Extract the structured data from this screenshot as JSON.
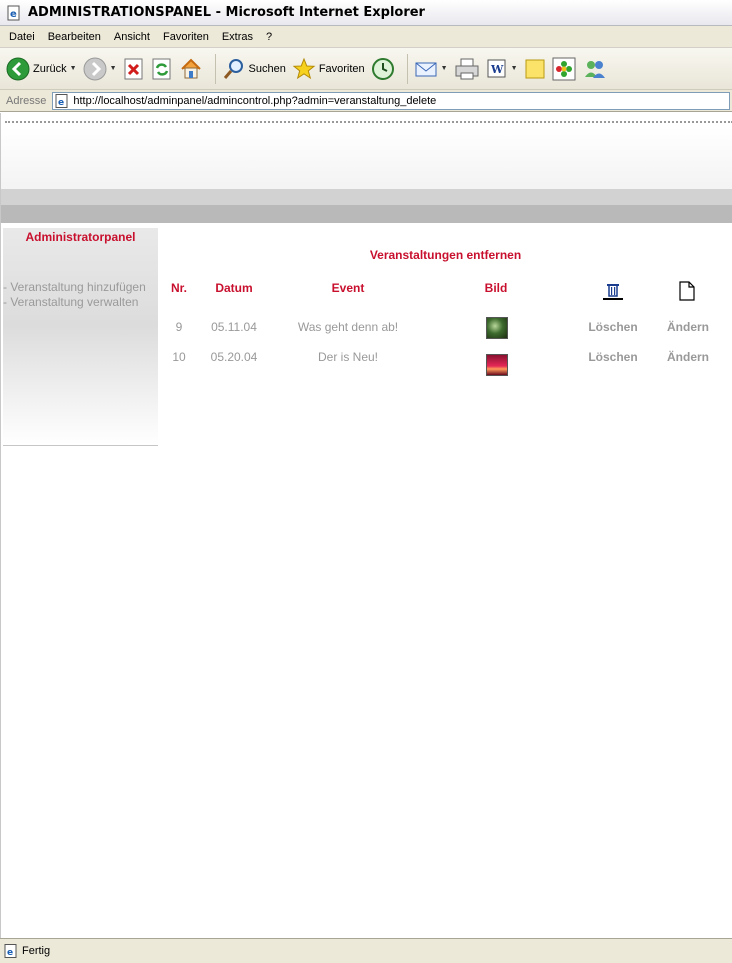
{
  "window": {
    "title": "ADMINISTRATIONSPANEL - Microsoft Internet Explorer"
  },
  "menu": {
    "items": [
      "Datei",
      "Bearbeiten",
      "Ansicht",
      "Favoriten",
      "Extras",
      "?"
    ]
  },
  "toolbar": {
    "back_label": "Zurück",
    "search_label": "Suchen",
    "favorites_label": "Favoriten"
  },
  "address": {
    "label": "Adresse",
    "url": "http://localhost/adminpanel/admincontrol.php?admin=veranstaltung_delete"
  },
  "sidebar": {
    "title": "Administratorpanel",
    "links": [
      "- Veranstaltung hinzufügen",
      "- Veranstaltung verwalten"
    ]
  },
  "main": {
    "heading": "Veranstaltungen entfernen",
    "columns": {
      "nr": "Nr.",
      "datum": "Datum",
      "event": "Event",
      "bild": "Bild"
    },
    "rows": [
      {
        "nr": "9",
        "datum": "05.11.04",
        "event": "Was geht denn ab!",
        "delete": "Löschen",
        "edit": "Ändern",
        "thumb_color": "#3d6b2e"
      },
      {
        "nr": "10",
        "datum": "05.20.04",
        "event": "Der is Neu!",
        "delete": "Löschen",
        "edit": "Ändern",
        "thumb_color": "#d8264a"
      }
    ]
  },
  "status": {
    "text": "Fertig"
  },
  "colors": {
    "accent": "#c8102e",
    "muted": "#999999"
  }
}
